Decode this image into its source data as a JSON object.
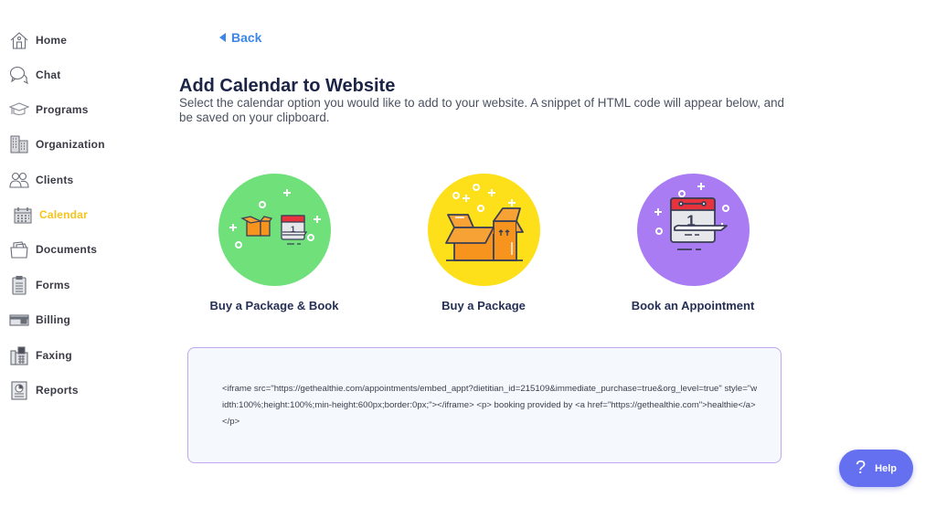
{
  "sidebar": {
    "items": [
      {
        "label": "Home",
        "icon": "home-icon",
        "active": false
      },
      {
        "label": "Chat",
        "icon": "chat-icon",
        "active": false
      },
      {
        "label": "Programs",
        "icon": "graduation-cap-icon",
        "active": false
      },
      {
        "label": "Organization",
        "icon": "building-icon",
        "active": false
      },
      {
        "label": "Clients",
        "icon": "users-icon",
        "active": false
      },
      {
        "label": "Calendar",
        "icon": "calendar-icon",
        "active": true
      },
      {
        "label": "Documents",
        "icon": "folder-icon",
        "active": false
      },
      {
        "label": "Forms",
        "icon": "clipboard-icon",
        "active": false
      },
      {
        "label": "Billing",
        "icon": "credit-card-icon",
        "active": false
      },
      {
        "label": "Faxing",
        "icon": "fax-icon",
        "active": false
      },
      {
        "label": "Reports",
        "icon": "report-icon",
        "active": false
      }
    ],
    "active_color": "#f7c31a"
  },
  "header": {
    "back_label": "Back",
    "title": "Add Calendar to Website",
    "description": "Select the calendar option you would like to add to your website. A snippet of HTML code will appear below, and be saved on your clipboard."
  },
  "options": [
    {
      "label": "Buy a Package & Book",
      "color": "#6fe07a",
      "illustration": "box-and-calendar-icon"
    },
    {
      "label": "Buy a Package",
      "color": "#fde01a",
      "illustration": "open-box-icon"
    },
    {
      "label": "Book an Appointment",
      "color": "#a97cf4",
      "illustration": "calendar-page-icon"
    }
  ],
  "code_snippet": "<iframe src=\"https://gethealthie.com/appointments/embed_appt?dietitian_id=215109&immediate_purchase=true&org_level=true\" style=\"width:100%;height:100%;min-height:600px;border:0px;\"></iframe> <p> booking provided by <a href=\"https://gethealthie.com\">healthie</a> </p>",
  "help": {
    "icon": "?",
    "label": "Help",
    "color": "#6470f0"
  }
}
